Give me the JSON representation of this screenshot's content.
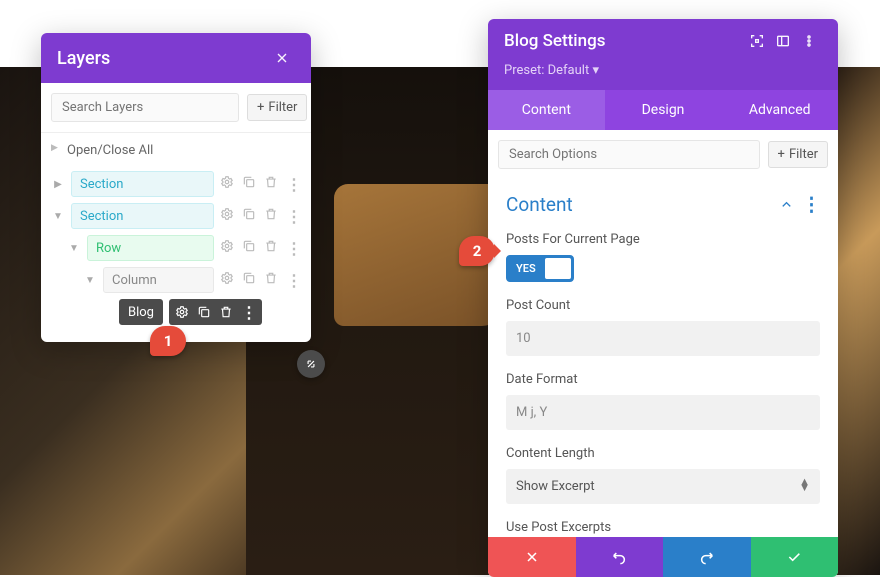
{
  "layers": {
    "title": "Layers",
    "search_placeholder": "Search Layers",
    "filter_label": "Filter",
    "open_close_all": "Open/Close All",
    "items": {
      "section1": "Section",
      "section2": "Section",
      "row": "Row",
      "column": "Column",
      "blog": "Blog"
    }
  },
  "settings": {
    "title": "Blog Settings",
    "preset_label": "Preset: Default",
    "tabs": {
      "content": "Content",
      "design": "Design",
      "advanced": "Advanced"
    },
    "search_placeholder": "Search Options",
    "filter_label": "Filter",
    "section_title": "Content",
    "fields": {
      "posts_current_label": "Posts For Current Page",
      "posts_current_yes": "YES",
      "post_count_label": "Post Count",
      "post_count_value": "10",
      "date_format_label": "Date Format",
      "date_format_value": "M j, Y",
      "content_length_label": "Content Length",
      "content_length_value": "Show Excerpt",
      "use_excerpts_label": "Use Post Excerpts"
    }
  },
  "callouts": {
    "c1": "1",
    "c2": "2"
  }
}
